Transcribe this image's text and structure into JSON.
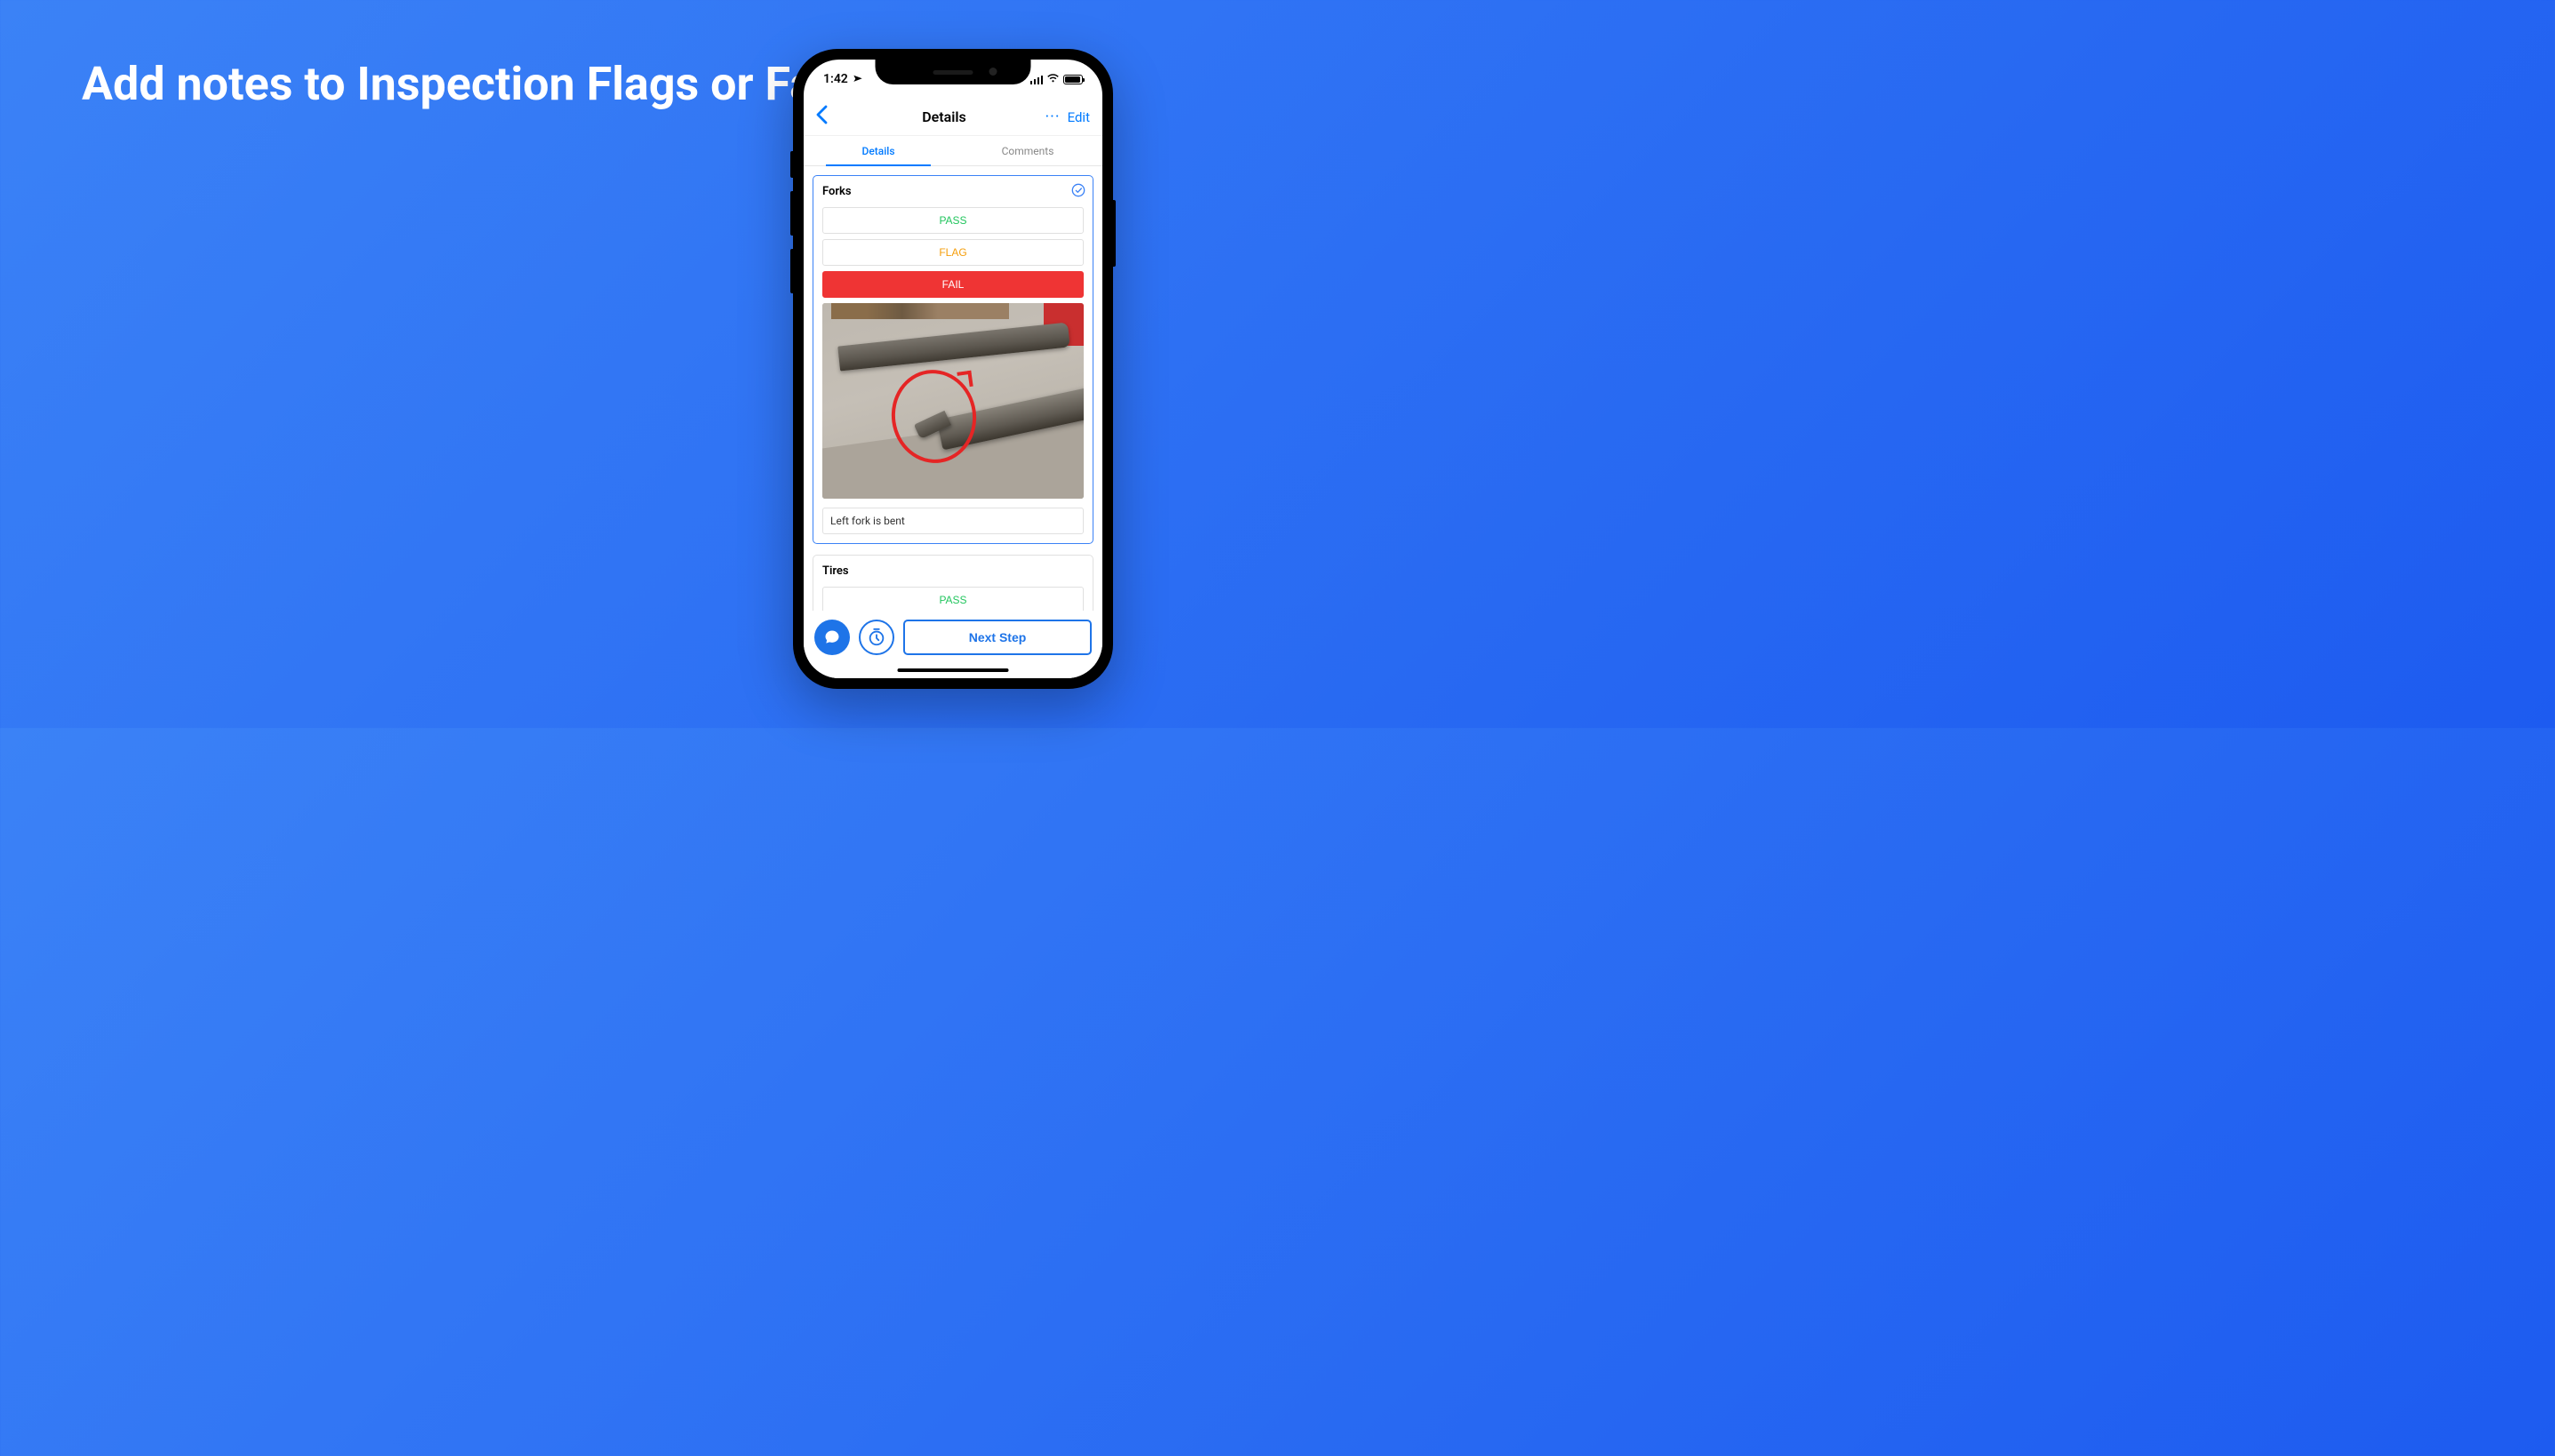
{
  "headline": "Add notes to Inspection Flags or Failures",
  "status_bar": {
    "time": "1:42",
    "location_icon": "location-arrow"
  },
  "nav": {
    "title": "Details",
    "more": "···",
    "edit": "Edit"
  },
  "tabs": {
    "details": "Details",
    "comments": "Comments"
  },
  "cards": {
    "forks": {
      "title": "Forks",
      "pass": "PASS",
      "flag": "FLAG",
      "fail": "FAIL",
      "note": "Left fork is bent"
    },
    "tires": {
      "title": "Tires",
      "pass": "PASS"
    }
  },
  "bottom": {
    "next_step": "Next Step"
  }
}
